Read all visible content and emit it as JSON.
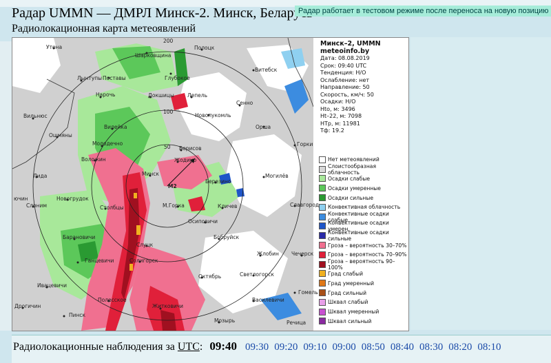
{
  "header": {
    "title": "Радар UMMN — ДМРЛ Минск-2. Минск, Беларусь",
    "notice": "Радар работает в тестовом режиме после переноса на новую позицию",
    "subtitle": "Радиолокационная карта метеоявлений"
  },
  "map": {
    "rings": [
      "200",
      "100",
      "50"
    ],
    "radar_label": "M2",
    "cities": [
      "Утена",
      "Шарковщина",
      "Полоцк",
      "Лынтупы",
      "Поставы",
      "Глубокое",
      "Витебск",
      "Нарочь",
      "Докшицы",
      "Лепель",
      "Сенно",
      "Вильнюс",
      "Новолукомль",
      "Ошмяны",
      "Вилейка",
      "Орша",
      "Горки",
      "Молодечно",
      "Борисов",
      "Воложин",
      "Жодино",
      "Лида",
      "Минск",
      "Березино",
      "Могилёв",
      "Новогрудок",
      "М.Горка",
      "Кличев",
      "Слоним",
      "Столбцы",
      "Осиповичи",
      "Славгород",
      "Барановичи",
      "Бобруйск",
      "Слуцк",
      "Чечерск",
      "Ганцевичи",
      "Солигорск",
      "Жлобин",
      "Ивацевичи",
      "Октябрь",
      "Светлогорск",
      "Гомель",
      "Дрогичин",
      "Полесское",
      "Житковичи",
      "Мозырь",
      "Пинск",
      "Василевичи"
    ],
    "partial": [
      "ючин",
      "Речица"
    ]
  },
  "info": {
    "station": "Минск–2, UMMN",
    "site": "meteoinfo.by",
    "lines": [
      "Дата: 08.08.2019",
      "Срок: 09:40 UTC",
      "Тенденция: Н/О",
      "Ослабление: нет",
      "Направление: 50",
      "Скорость, км/ч: 50",
      "Осадки: Н/О",
      "Нto, м: 3496",
      "Нt–22, м: 7098",
      "НТр, м: 11981",
      "Тф: 19.2"
    ]
  },
  "legend": [
    {
      "label": "Нет метеоявлений",
      "color": "#ffffff"
    },
    {
      "label": "Слоистообразная облачность",
      "color": "#d8d8d8"
    },
    {
      "label": "Осадки слабые",
      "color": "#a8e89a"
    },
    {
      "label": "Осадки умеренные",
      "color": "#5cc85a"
    },
    {
      "label": "Осадки сильные",
      "color": "#2a9a32"
    },
    {
      "label": "Конвективная облачность",
      "color": "#8fd0f0"
    },
    {
      "label": "Конвективные осадки слабые",
      "color": "#3c8ce0"
    },
    {
      "label": "Конвективные осадки умерен.",
      "color": "#1f55c8"
    },
    {
      "label": "Конвективные осадки сильные",
      "color": "#2a2aa8"
    },
    {
      "label": "Гроза – вероятность 30–70%",
      "color": "#f07090"
    },
    {
      "label": "Гроза – вероятность 70–90%",
      "color": "#e0203a"
    },
    {
      "label": "Гроза – вероятность 90–100%",
      "color": "#a01020"
    },
    {
      "label": "Град слабый",
      "color": "#f0b020"
    },
    {
      "label": "Град умеренный",
      "color": "#e07818"
    },
    {
      "label": "Град сильный",
      "color": "#a85018"
    },
    {
      "label": "Шквал слабый",
      "color": "#e8a0e8"
    },
    {
      "label": "Шквал умеренный",
      "color": "#c850d0"
    },
    {
      "label": "Шквал сильный",
      "color": "#8a2aa0"
    }
  ],
  "observations": {
    "prefix": "Радиолокационные наблюдения за",
    "utc": "UTC",
    "colon": ":",
    "current": "09:40",
    "times": [
      "09:30",
      "09:20",
      "09:10",
      "09:00",
      "08:50",
      "08:40",
      "08:30",
      "08:20",
      "08:10"
    ]
  }
}
